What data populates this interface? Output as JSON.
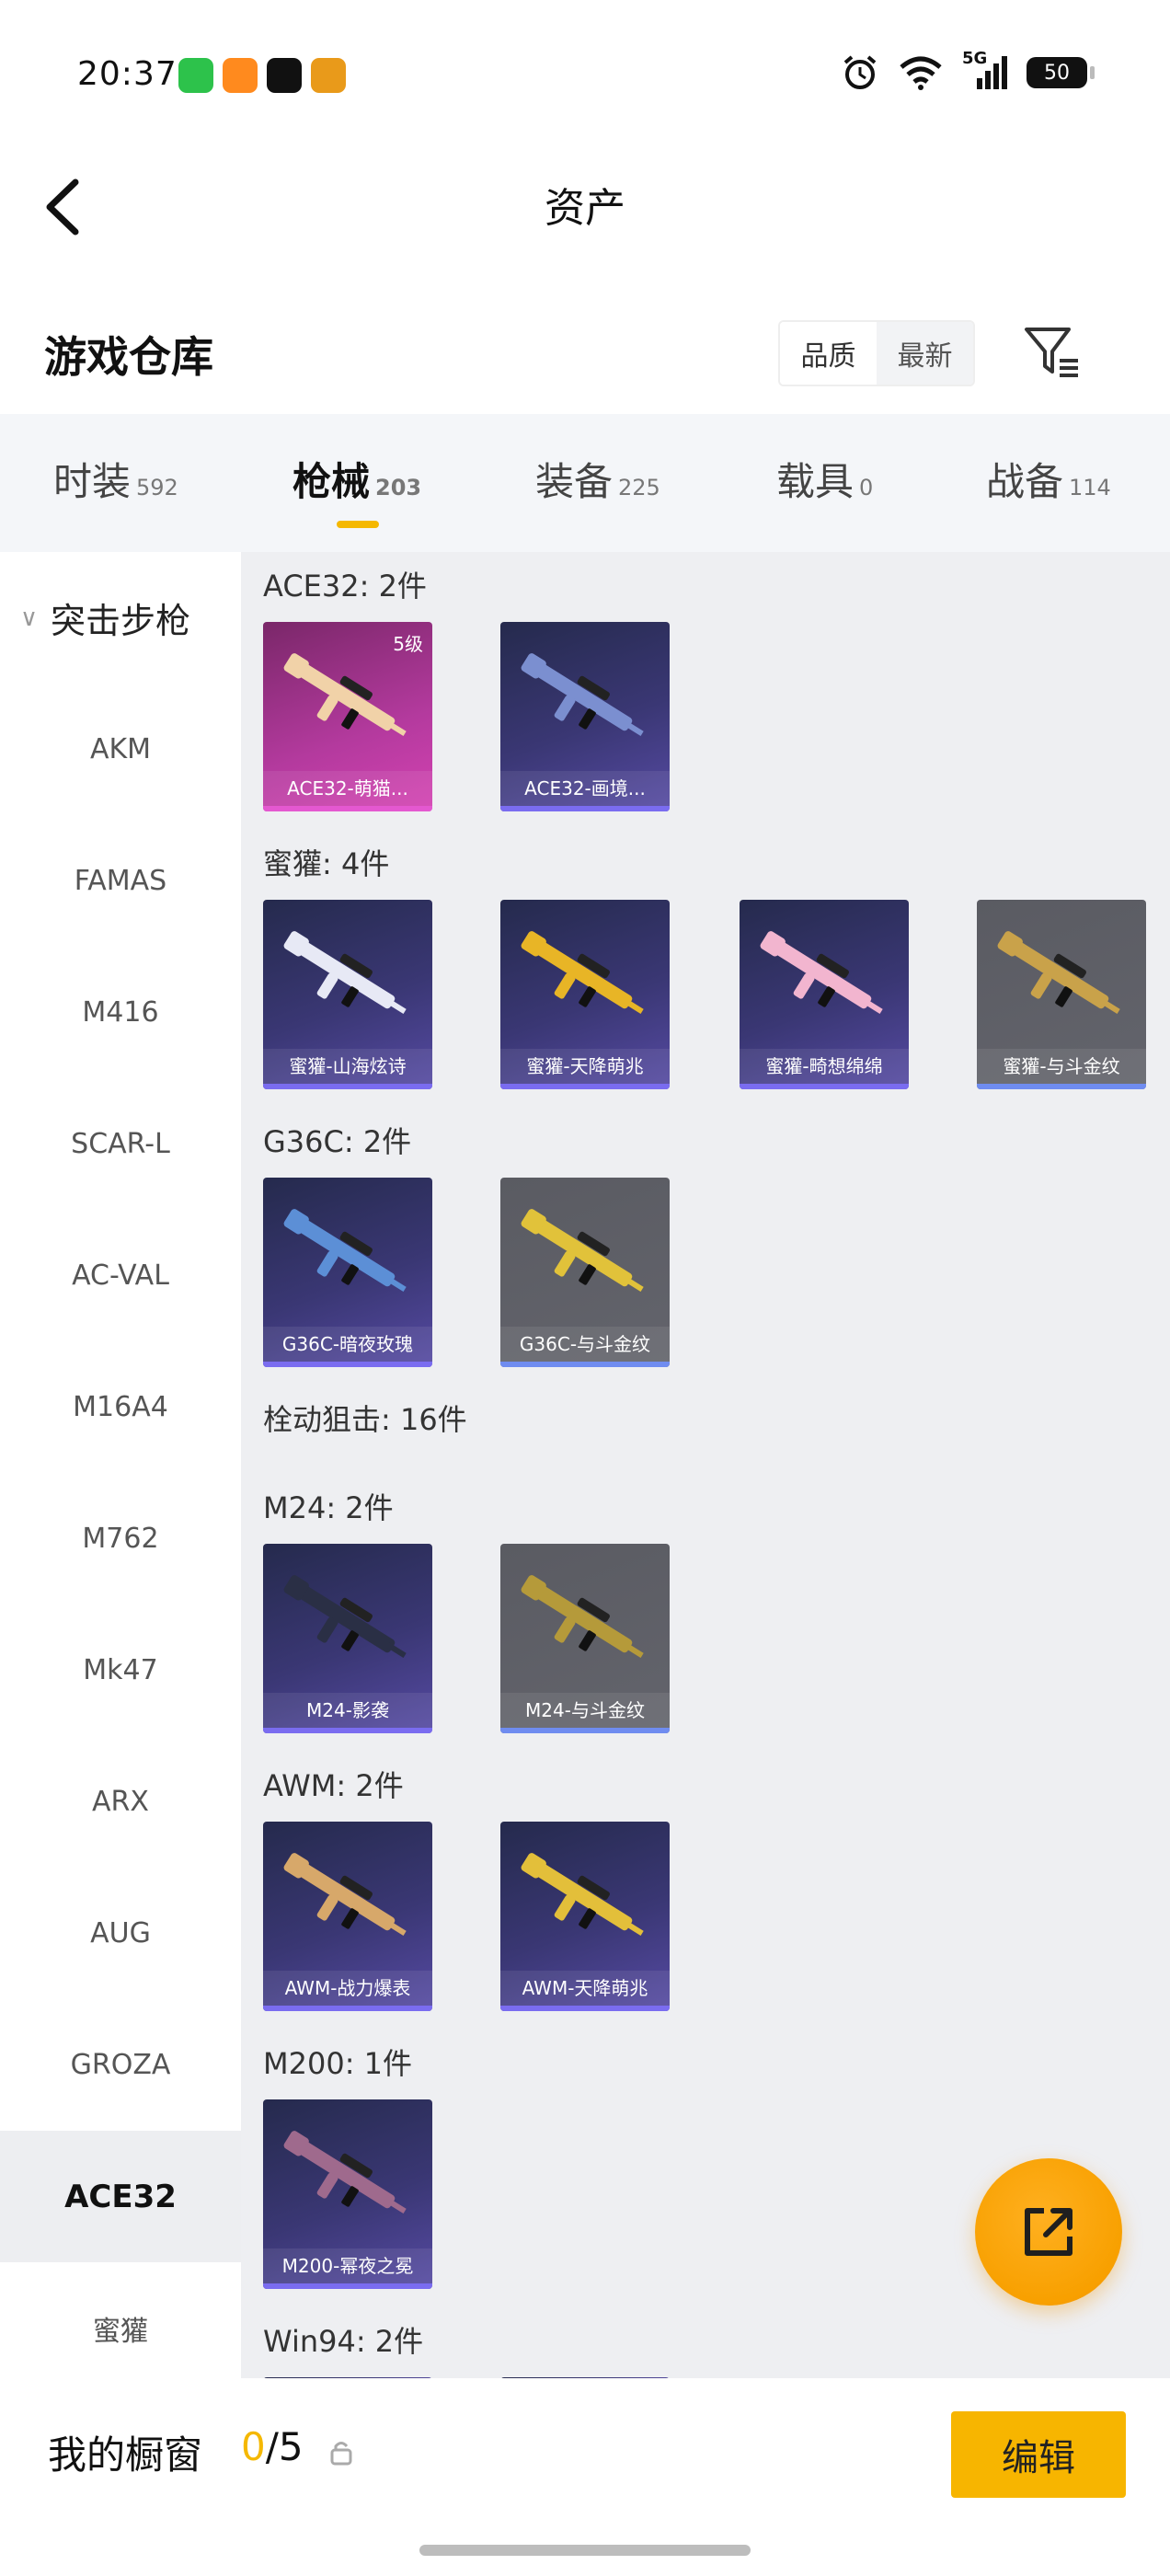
{
  "status_bar": {
    "time": "20:37",
    "apps": [
      {
        "icon": "wechat-icon",
        "color": "#2dc24b"
      },
      {
        "icon": "taobao-flash-icon",
        "color": "#ff8a1e"
      },
      {
        "icon": "tiktok-icon",
        "color": "#111111"
      },
      {
        "icon": "game-app-icon",
        "color": "#e99a1a"
      }
    ],
    "network": "5G",
    "battery": "50"
  },
  "header": {
    "title": "资产"
  },
  "warehouse": {
    "title": "游戏仓库",
    "sort_options": [
      "品质",
      "最新"
    ],
    "active_sort": "品质"
  },
  "tabs": [
    {
      "label": "时装",
      "count": "592"
    },
    {
      "label": "枪械",
      "count": "203",
      "active": true
    },
    {
      "label": "装备",
      "count": "225"
    },
    {
      "label": "载具",
      "count": "0"
    },
    {
      "label": "战备",
      "count": "114"
    }
  ],
  "sidebar": {
    "group_label": "突击步枪",
    "items": [
      "AKM",
      "FAMAS",
      "M416",
      "SCAR-L",
      "AC-VAL",
      "M16A4",
      "M762",
      "Mk47",
      "ARX",
      "AUG",
      "GROZA",
      "ACE32",
      "蜜獾"
    ],
    "active_item": "ACE32"
  },
  "sections": [
    {
      "title": "ACE32: 2件",
      "items": [
        {
          "name": "ACE32-萌猫...",
          "rarity": "pink",
          "badge": "5级",
          "gun_color": "#f1d2a8"
        },
        {
          "name": "ACE32-画境...",
          "rarity": "purple",
          "gun_color": "#7b8fd0"
        }
      ]
    },
    {
      "title": "蜜獾: 4件",
      "items": [
        {
          "name": "蜜獾-山海炫诗",
          "rarity": "purple",
          "gun_color": "#e7e9f5"
        },
        {
          "name": "蜜獾-天降萌兆",
          "rarity": "purple",
          "gun_color": "#e8b526"
        },
        {
          "name": "蜜獾-畸想绵绵",
          "rarity": "purple",
          "gun_color": "#f2b5cf"
        },
        {
          "name": "蜜獾-与斗金纹",
          "rarity": "grey",
          "gun_color": "#c9a24a"
        }
      ]
    },
    {
      "title": "G36C: 2件",
      "items": [
        {
          "name": "G36C-暗夜玫瑰",
          "rarity": "purple",
          "gun_color": "#5c8fd6"
        },
        {
          "name": "G36C-与斗金纹",
          "rarity": "grey",
          "gun_color": "#e1c23a"
        }
      ]
    },
    {
      "title": "栓动狙击: 16件",
      "items": []
    },
    {
      "title": "M24: 2件",
      "items": [
        {
          "name": "M24-影袭",
          "rarity": "purple",
          "gun_color": "#2a2f45"
        },
        {
          "name": "M24-与斗金纹",
          "rarity": "grey",
          "gun_color": "#b59a3a"
        }
      ]
    },
    {
      "title": "AWM: 2件",
      "items": [
        {
          "name": "AWM-战力爆表",
          "rarity": "purple",
          "gun_color": "#d7a86a"
        },
        {
          "name": "AWM-天降萌兆",
          "rarity": "purple",
          "gun_color": "#e3bf3a"
        }
      ]
    },
    {
      "title": "M200: 1件",
      "items": [
        {
          "name": "M200-幂夜之冕",
          "rarity": "purple",
          "gun_color": "#9f6a8d"
        }
      ]
    },
    {
      "title": "Win94: 2件",
      "items": []
    }
  ],
  "bottom_bar": {
    "label": "我的橱窗",
    "count_current": "0",
    "count_total": "/5",
    "edit_label": "编辑"
  },
  "colors": {
    "accent": "#f5b800",
    "fab": "#f8a000"
  }
}
